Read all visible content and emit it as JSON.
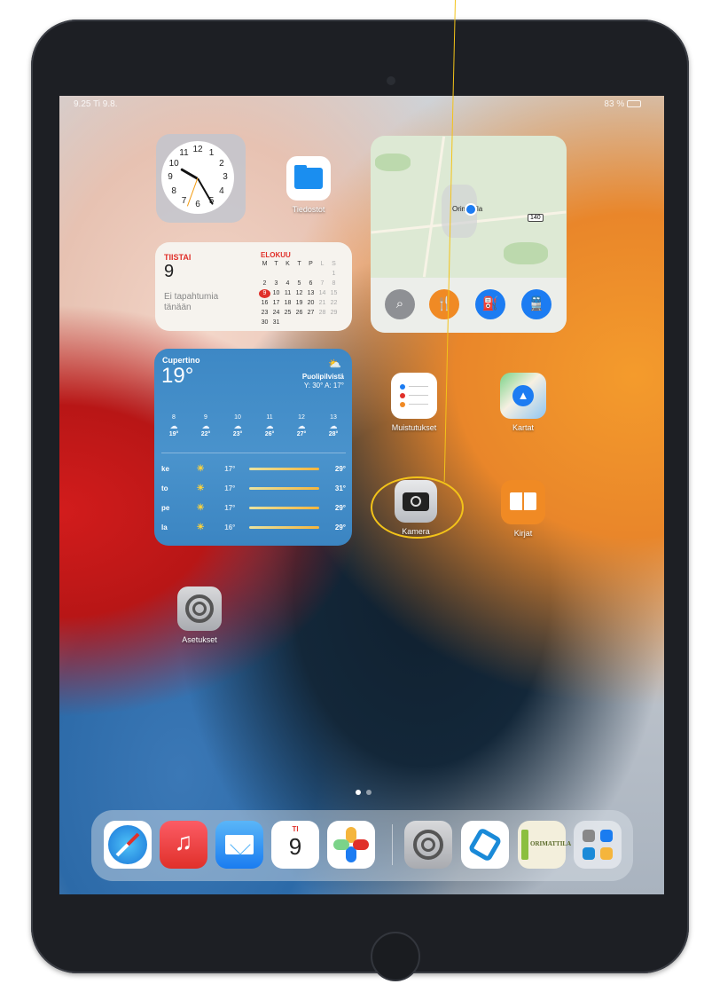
{
  "status_bar": {
    "time_date": "9.25 Ti 9.8.",
    "battery": "83 %"
  },
  "clock_numbers": [
    "12",
    "1",
    "2",
    "3",
    "4",
    "5",
    "6",
    "7",
    "8",
    "9",
    "10",
    "11"
  ],
  "calendar": {
    "weekday": "TIISTAI",
    "date": "9",
    "note": "Ei tapahtumia tänään",
    "month": "ELOKUU",
    "weekday_headers": [
      "M",
      "T",
      "K",
      "T",
      "P",
      "L",
      "S"
    ],
    "days": [
      "1",
      "2",
      "3",
      "4",
      "5",
      "6",
      "7",
      "8",
      "9",
      "10",
      "11",
      "12",
      "13",
      "14",
      "15",
      "16",
      "17",
      "18",
      "19",
      "20",
      "21",
      "22",
      "23",
      "24",
      "25",
      "26",
      "27",
      "28",
      "29",
      "30",
      "31"
    ],
    "today": "9"
  },
  "maps_widget": {
    "place": "Orimattila",
    "route_shield": "140"
  },
  "weather": {
    "city": "Cupertino",
    "temp": "19°",
    "condition": "Puolipilvistä",
    "range": "Y: 30° A: 17°",
    "hourly": [
      {
        "h": "8",
        "t": "19°"
      },
      {
        "h": "9",
        "t": "22°"
      },
      {
        "h": "10",
        "t": "23°"
      },
      {
        "h": "11",
        "t": "26°"
      },
      {
        "h": "12",
        "t": "27°"
      },
      {
        "h": "13",
        "t": "28°"
      }
    ],
    "daily": [
      {
        "d": "ke",
        "lo": "17°",
        "hi": "29°"
      },
      {
        "d": "to",
        "lo": "17°",
        "hi": "31°"
      },
      {
        "d": "pe",
        "lo": "17°",
        "hi": "29°"
      },
      {
        "d": "la",
        "lo": "16°",
        "hi": "29°"
      }
    ]
  },
  "apps": {
    "files": "Tiedostot",
    "reminders": "Muistutukset",
    "maps": "Kartat",
    "camera": "Kamera",
    "books": "Kirjat",
    "settings": "Asetukset"
  },
  "dock": {
    "calendar_day": "TI",
    "calendar_date": "9",
    "orimattila_label": "ORIMATTILA"
  },
  "colors": {
    "annotation": "#f3c319",
    "calendar_red": "#e0302a",
    "weather_blue": "#3d88c5"
  }
}
